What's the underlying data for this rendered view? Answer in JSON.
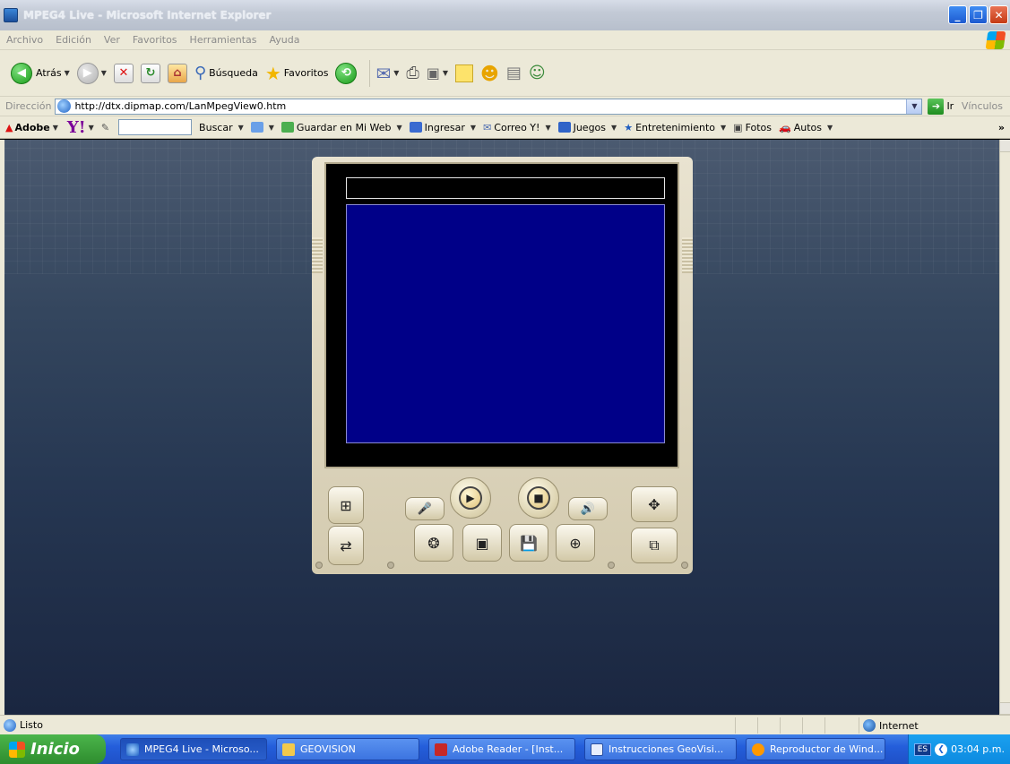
{
  "window": {
    "title": "MPEG4 Live - Microsoft Internet Explorer",
    "minimize": "_",
    "restore": "❐",
    "close": "✕"
  },
  "menu": [
    "Archivo",
    "Edición",
    "Ver",
    "Favoritos",
    "Herramientas",
    "Ayuda"
  ],
  "toolbar": {
    "back_label": "Atrás",
    "search_label": "Búsqueda",
    "favorites_label": "Favoritos"
  },
  "address": {
    "label": "Dirección",
    "url": "http://dtx.dipmap.com/LanMpegView0.htm",
    "go_label": "Ir",
    "links_label": "Vínculos"
  },
  "yahoo_bar": {
    "adobe_label": "Adobe",
    "yahoo_logo": "Y!",
    "search_button": "Buscar",
    "save_web": "Guardar en Mi Web",
    "signin": "Ingresar",
    "mail": "Correo Y!",
    "games": "Juegos",
    "entertainment": "Entretenimiento",
    "photos": "Fotos",
    "autos": "Autos",
    "more": "»"
  },
  "player": {
    "controls": [
      "network",
      "microphone",
      "play",
      "stop",
      "speaker",
      "ptz",
      "switch-camera",
      "snapshot",
      "record",
      "save",
      "zoom",
      "settings"
    ]
  },
  "status": {
    "text": "Listo",
    "zone": "Internet"
  },
  "taskbar": {
    "start": "Inicio",
    "tasks": [
      {
        "label": "MPEG4 Live - Microso..."
      },
      {
        "label": "GEOVISION"
      },
      {
        "label": "Adobe Reader - [Inst..."
      },
      {
        "label": "Instrucciones GeoVisi..."
      },
      {
        "label": "Reproductor de Wind..."
      }
    ],
    "lang": "ES",
    "clock": "03:04 p.m."
  }
}
